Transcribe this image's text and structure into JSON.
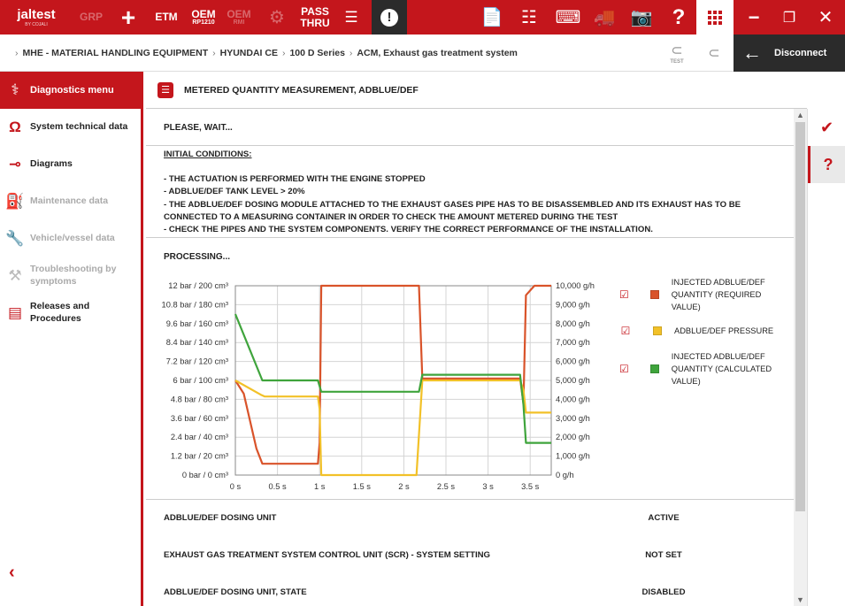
{
  "toolbar": {
    "logo": "jaltest",
    "logo_sub": "BY COJALI",
    "grp": "GRP",
    "etm": "ETM",
    "oem1": "OEM",
    "oem1_sub": "RP1210",
    "oem2": "OEM",
    "oem2_sub": "RMI",
    "pass": "PASS",
    "pass_sub": "THRU",
    "warn": "!",
    "help": "?"
  },
  "breadcrumb": {
    "items": [
      "MHE - MATERIAL HANDLING EQUIPMENT",
      "HYUNDAI CE",
      "100 D Series",
      "ACM, Exhaust gas treatment system"
    ],
    "test_label": "TEST",
    "disconnect": "Disconnect"
  },
  "sidebar": {
    "header": "Diagnostics menu",
    "items": [
      {
        "label": "System technical data",
        "icon": "omega-icon",
        "glyph": "Ω",
        "enabled": true
      },
      {
        "label": "Diagrams",
        "icon": "diagram-icon",
        "glyph": "⊸",
        "enabled": true
      },
      {
        "label": "Maintenance data",
        "icon": "oil-can-icon",
        "glyph": "⛽",
        "enabled": false
      },
      {
        "label": "Vehicle/vessel data",
        "icon": "wrench-icon",
        "glyph": "🔧",
        "enabled": false
      },
      {
        "label": "Troubleshooting by symptoms",
        "icon": "tools-icon",
        "glyph": "⚒",
        "enabled": false
      },
      {
        "label": "Releases and Procedures",
        "icon": "book-icon",
        "glyph": "▤",
        "enabled": true
      }
    ]
  },
  "main": {
    "title": "METERED QUANTITY MEASUREMENT, ADBLUE/DEF",
    "please_wait": "PLEASE, WAIT...",
    "conditions_title": "INITIAL CONDITIONS:",
    "conditions": [
      "- THE ACTUATION IS PERFORMED WITH THE ENGINE STOPPED",
      "- ADBLUE/DEF TANK LEVEL > 20%",
      "- THE ADBLUE/DEF DOSING MODULE ATTACHED TO THE EXHAUST GASES PIPE HAS TO BE DISASSEMBLED AND ITS EXHAUST HAS TO BE CONNECTED TO A MEASURING CONTAINER IN ORDER TO CHECK THE AMOUNT METERED DURING THE TEST",
      "- CHECK THE PIPES AND THE SYSTEM COMPONENTS. VERIFY THE CORRECT PERFORMANCE OF THE INSTALLATION."
    ],
    "processing": "PROCESSING...",
    "status_rows": [
      {
        "label": "ADBLUE/DEF DOSING UNIT",
        "value": "ACTIVE"
      },
      {
        "label": "EXHAUST GAS TREATMENT SYSTEM CONTROL UNIT (SCR) - SYSTEM SETTING",
        "value": "NOT SET"
      },
      {
        "label": "ADBLUE/DEF DOSING UNIT, STATE",
        "value": "DISABLED"
      }
    ]
  },
  "chart_data": {
    "type": "line",
    "x_tick_labels": [
      "0 s",
      "0.5 s",
      "1 s",
      "1.5 s",
      "2 s",
      "2.5 s",
      "3 s",
      "3.5 s"
    ],
    "xlim": [
      0,
      3.75
    ],
    "left_tick_labels": [
      "0 bar / 0 cm³",
      "1.2 bar / 20 cm³",
      "2.4 bar / 40 cm³",
      "3.6 bar / 60 cm³",
      "4.8 bar / 80 cm³",
      "6 bar / 100 cm³",
      "7.2 bar / 120 cm³",
      "8.4 bar / 140 cm³",
      "9.6 bar / 160 cm³",
      "10.8 bar / 180 cm³",
      "12 bar / 200 cm³"
    ],
    "right_tick_labels": [
      "0 g/h",
      "1,000 g/h",
      "2,000 g/h",
      "3,000 g/h",
      "4,000 g/h",
      "5,000 g/h",
      "6,000 g/h",
      "7,000 g/h",
      "8,000 g/h",
      "9,000 g/h",
      "10,000 g/h"
    ],
    "ylim": [
      0,
      10000
    ],
    "grid": true,
    "legend_position": "right",
    "series": [
      {
        "name": "INJECTED ADBLUE/DEF QUANTITY (REQUIRED VALUE)",
        "color": "#d9532a",
        "x": [
          0,
          0.1,
          0.25,
          0.32,
          0.55,
          0.98,
          1.0,
          1.02,
          1.1,
          2.18,
          2.22,
          3.38,
          3.42,
          3.45,
          3.55,
          3.75
        ],
        "y": [
          5000,
          4300,
          1400,
          600,
          600,
          600,
          1700,
          10000,
          10000,
          10000,
          5100,
          5100,
          3800,
          9500,
          10000,
          10000
        ]
      },
      {
        "name": "ADBLUE/DEF PRESSURE",
        "color": "#f2c128",
        "x": [
          0,
          0.3,
          0.35,
          0.98,
          1.0,
          1.02,
          1.1,
          2.15,
          2.22,
          3.38,
          3.42,
          3.45,
          3.55,
          3.75
        ],
        "y": [
          5000,
          4250,
          4150,
          4150,
          3500,
          0,
          0,
          0,
          5000,
          5000,
          4500,
          3300,
          3300,
          3300
        ],
        "y_left_axis_at_5000": "6 bar / 100 cm³"
      },
      {
        "name": "INJECTED ADBLUE/DEF QUANTITY (CALCULATED VALUE)",
        "color": "#3fa43c",
        "x": [
          0,
          0.32,
          0.98,
          1.02,
          2.18,
          2.22,
          3.38,
          3.42,
          3.45,
          3.55,
          3.75
        ],
        "y": [
          8500,
          5000,
          5000,
          4400,
          4400,
          5300,
          5300,
          3700,
          1700,
          1700,
          1700
        ]
      }
    ]
  },
  "colors": {
    "brand": "#c4161c",
    "dark": "#2b2b2b"
  }
}
